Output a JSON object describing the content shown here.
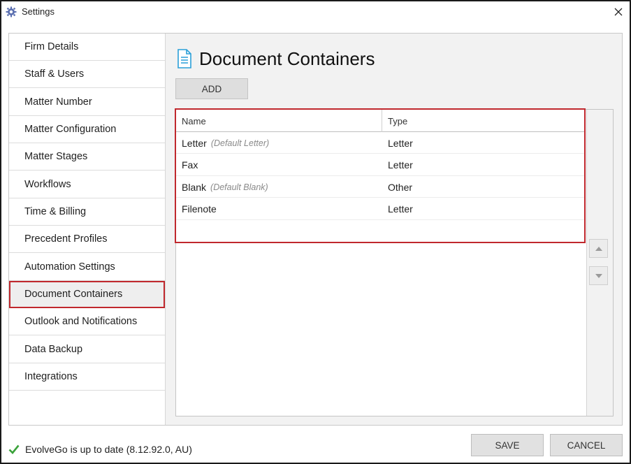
{
  "window": {
    "title": "Settings",
    "app_icon": "gear-icon",
    "close_icon": "close-icon"
  },
  "sidebar": {
    "items": [
      {
        "label": "Firm Details"
      },
      {
        "label": "Staff & Users"
      },
      {
        "label": "Matter Number"
      },
      {
        "label": "Matter Configuration"
      },
      {
        "label": "Matter Stages"
      },
      {
        "label": "Workflows"
      },
      {
        "label": "Time & Billing"
      },
      {
        "label": "Precedent Profiles"
      },
      {
        "label": "Automation Settings"
      },
      {
        "label": "Document Containers",
        "selected": true
      },
      {
        "label": "Outlook and Notifications"
      },
      {
        "label": "Data Backup"
      },
      {
        "label": "Integrations"
      }
    ]
  },
  "main": {
    "title": "Document Containers",
    "title_icon": "document-icon",
    "add_label": "ADD",
    "table": {
      "columns": [
        "Name",
        "Type"
      ],
      "rows": [
        {
          "name": "Letter",
          "default": "(Default Letter)",
          "type": "Letter"
        },
        {
          "name": "Fax",
          "default": "",
          "type": "Letter"
        },
        {
          "name": "Blank",
          "default": "(Default Blank)",
          "type": "Other"
        },
        {
          "name": "Filenote",
          "default": "",
          "type": "Letter"
        }
      ]
    },
    "move_up_icon": "arrow-up-icon",
    "move_down_icon": "arrow-down-icon"
  },
  "footer": {
    "status_icon": "check-icon",
    "status_text": "EvolveGo is up to date (8.12.92.0, AU)",
    "save_label": "SAVE",
    "cancel_label": "CANCEL"
  },
  "colors": {
    "highlight": "#c0282d",
    "accent_icon": "#2a9fd8",
    "status_ok": "#3aa23a"
  }
}
